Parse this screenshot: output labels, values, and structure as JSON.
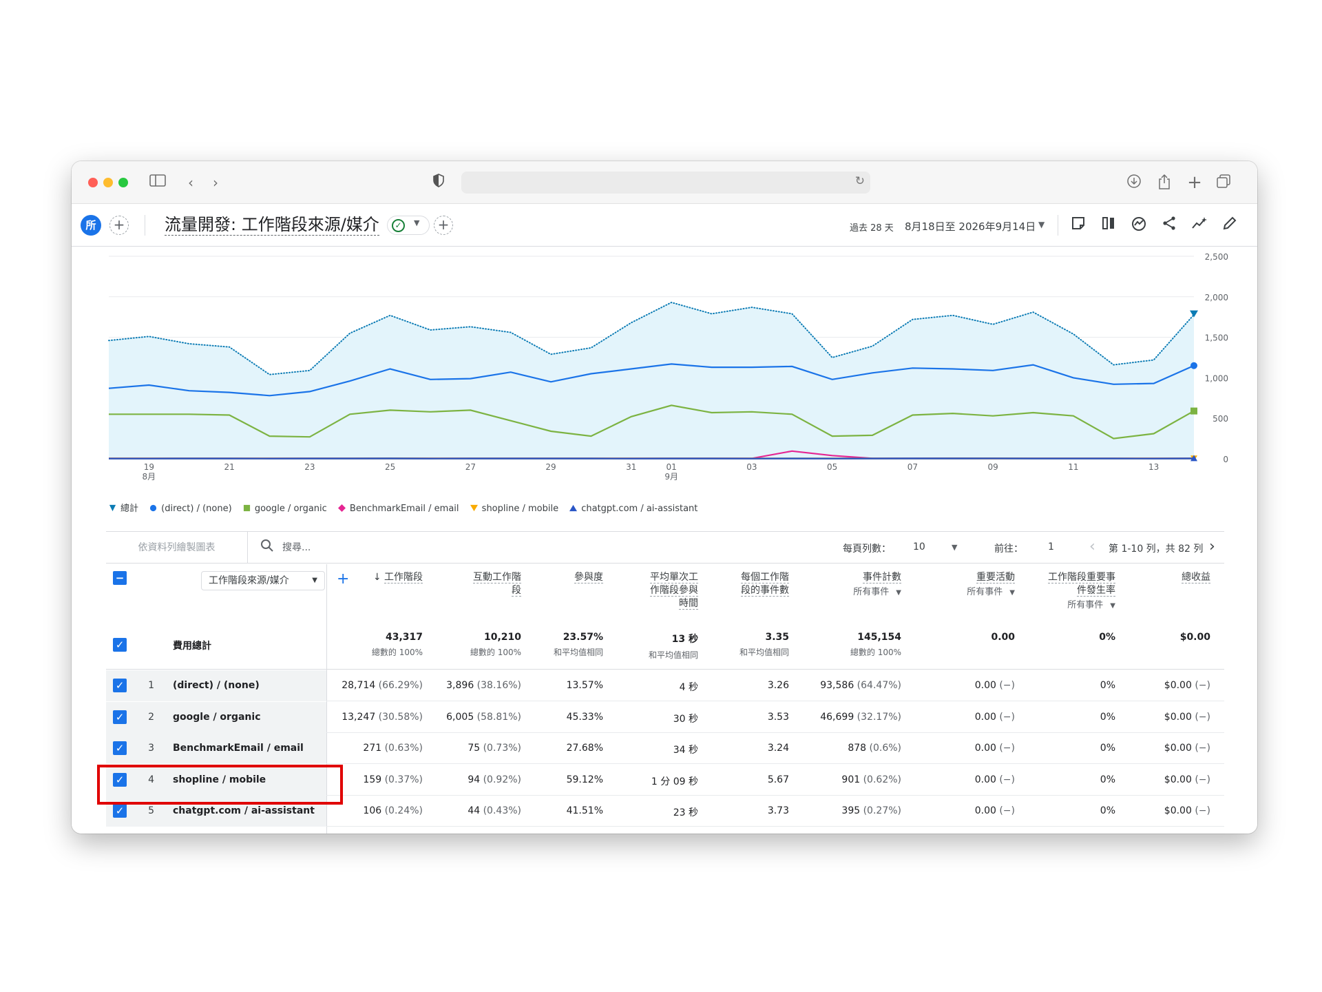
{
  "app": {
    "avatar": "所",
    "report_title": "流量開發: 工作階段來源/媒介",
    "date_label": "過去 28 天",
    "date_range": "8月18日至 2026年9月14日"
  },
  "chart_data": {
    "type": "line",
    "ylim": [
      0,
      2500
    ],
    "yticks": [
      "2,500",
      "2,000",
      "1,500",
      "1,000",
      "500",
      "0"
    ],
    "ytick_values": [
      2500,
      2000,
      1500,
      1000,
      500,
      0
    ],
    "xtick_labels": [
      {
        "i": 2,
        "day": "19",
        "month": "8月"
      },
      {
        "i": 4,
        "day": "21",
        "month": ""
      },
      {
        "i": 6,
        "day": "23",
        "month": ""
      },
      {
        "i": 8,
        "day": "25",
        "month": ""
      },
      {
        "i": 10,
        "day": "27",
        "month": ""
      },
      {
        "i": 12,
        "day": "29",
        "month": ""
      },
      {
        "i": 14,
        "day": "31",
        "month": ""
      },
      {
        "i": 15,
        "day": "01",
        "month": "9月"
      },
      {
        "i": 17,
        "day": "03",
        "month": ""
      },
      {
        "i": 19,
        "day": "05",
        "month": ""
      },
      {
        "i": 21,
        "day": "07",
        "month": ""
      },
      {
        "i": 23,
        "day": "09",
        "month": ""
      },
      {
        "i": 25,
        "day": "11",
        "month": ""
      },
      {
        "i": 27,
        "day": "13",
        "month": ""
      }
    ],
    "x": [
      "08-17",
      "08-18",
      "08-19",
      "08-20",
      "08-21",
      "08-22",
      "08-23",
      "08-24",
      "08-25",
      "08-26",
      "08-27",
      "08-28",
      "08-29",
      "08-30",
      "08-31",
      "09-01",
      "09-02",
      "09-03",
      "09-04",
      "09-05",
      "09-06",
      "09-07",
      "09-08",
      "09-09",
      "09-10",
      "09-11",
      "09-12",
      "09-13",
      "09-14"
    ],
    "series": [
      {
        "name": "總計",
        "color": "#0b7bb4",
        "style": "dotted-area",
        "values": [
          1460,
          1510,
          1420,
          1380,
          1040,
          1090,
          1550,
          1770,
          1590,
          1630,
          1560,
          1290,
          1370,
          1680,
          1930,
          1790,
          1870,
          1790,
          1250,
          1390,
          1720,
          1770,
          1660,
          1810,
          1540,
          1160,
          1220,
          1780
        ]
      },
      {
        "name": "(direct) / (none)",
        "color": "#1a73e8",
        "style": "line",
        "values": [
          870,
          910,
          840,
          820,
          780,
          830,
          960,
          1110,
          980,
          990,
          1070,
          950,
          1050,
          1110,
          1170,
          1130,
          1130,
          1140,
          980,
          1060,
          1120,
          1110,
          1090,
          1160,
          1000,
          920,
          930,
          1150
        ]
      },
      {
        "name": "google / organic",
        "color": "#7cb342",
        "style": "line",
        "values": [
          550,
          550,
          550,
          540,
          280,
          270,
          550,
          600,
          580,
          600,
          470,
          340,
          280,
          520,
          660,
          570,
          580,
          550,
          280,
          290,
          540,
          560,
          530,
          570,
          530,
          250,
          310,
          590
        ]
      },
      {
        "name": "BenchmarkEmail / email",
        "color": "#e52592",
        "style": "line",
        "values": [
          5,
          5,
          5,
          5,
          5,
          5,
          5,
          5,
          5,
          5,
          5,
          5,
          5,
          5,
          5,
          5,
          5,
          95,
          40,
          5,
          5,
          8,
          6,
          5,
          5,
          5,
          5,
          5
        ]
      },
      {
        "name": "shopline / mobile",
        "color": "#f9ab00",
        "style": "line",
        "values": [
          5,
          5,
          6,
          5,
          5,
          6,
          6,
          7,
          5,
          6,
          5,
          5,
          6,
          5,
          6,
          6,
          5,
          5,
          5,
          6,
          6,
          7,
          7,
          6,
          5,
          5,
          6,
          6
        ]
      },
      {
        "name": "chatgpt.com / ai-assistant",
        "color": "#2a56c6",
        "style": "line",
        "values": [
          3,
          3,
          4,
          4,
          3,
          4,
          4,
          5,
          3,
          4,
          4,
          4,
          4,
          3,
          4,
          4,
          3,
          4,
          3,
          4,
          5,
          5,
          6,
          4,
          4,
          4,
          3,
          5
        ]
      }
    ]
  },
  "legend_icons": [
    "pin-icon",
    "circle-icon",
    "square-icon",
    "diamond-icon",
    "triangle-down-icon",
    "triangle-up-icon"
  ],
  "toolbar": {
    "plot_rows_label": "依資料列繪製圖表",
    "search_placeholder": "搜尋...",
    "rows_per_page_label": "每頁列數：",
    "rows_per_page_value": "10",
    "goto_label": "前往：",
    "goto_value": "1",
    "pagination_text": "第 1-10 列，共 82 列"
  },
  "table": {
    "dimension_label": "工作階段來源/媒介",
    "columns": [
      {
        "title": "工作階段",
        "sorted": true,
        "sub": ""
      },
      {
        "title": "互動工作階段",
        "sub": ""
      },
      {
        "title": "參與度",
        "sub": ""
      },
      {
        "title": "平均單次工作階段參與時間",
        "sub": ""
      },
      {
        "title": "每個工作階段的事件數",
        "sub": ""
      },
      {
        "title": "事件計數",
        "sub": "所有事件"
      },
      {
        "title": "重要活動",
        "sub": "所有事件"
      },
      {
        "title": "工作階段重要事件發生率",
        "sub": "所有事件"
      },
      {
        "title": "總收益",
        "sub": ""
      }
    ],
    "col_title_lines": [
      [
        "工作階段"
      ],
      [
        "互動工作階",
        "段"
      ],
      [
        "參與度"
      ],
      [
        "平均單次工",
        "作階段參與",
        "時間"
      ],
      [
        "每個工作階",
        "段的事件數"
      ],
      [
        "事件計數"
      ],
      [
        "重要活動"
      ],
      [
        "工作階段重要事",
        "件發生率"
      ],
      [
        "總收益"
      ]
    ],
    "totals_label": "費用總計",
    "totals": [
      {
        "v": "43,317",
        "p": "總數的 100%"
      },
      {
        "v": "10,210",
        "p": "總數的 100%"
      },
      {
        "v": "23.57%",
        "p": "和平均值相同"
      },
      {
        "v": "13 秒",
        "p": "和平均值相同"
      },
      {
        "v": "3.35",
        "p": "和平均值相同"
      },
      {
        "v": "145,154",
        "p": "總數的 100%"
      },
      {
        "v": "0.00",
        "p": ""
      },
      {
        "v": "0%",
        "p": ""
      },
      {
        "v": "$0.00",
        "p": ""
      }
    ],
    "rows": [
      {
        "idx": "1",
        "dim": "(direct) / (none)",
        "cells": [
          [
            "28,714",
            "(66.29%)"
          ],
          [
            "3,896",
            "(38.16%)"
          ],
          [
            "13.57%",
            ""
          ],
          [
            "4 秒",
            ""
          ],
          [
            "3.26",
            ""
          ],
          [
            "93,586",
            "(64.47%)"
          ],
          [
            "0.00",
            "(−)"
          ],
          [
            "0%",
            ""
          ],
          [
            "$0.00",
            "(−)"
          ]
        ]
      },
      {
        "idx": "2",
        "dim": "google / organic",
        "cells": [
          [
            "13,247",
            "(30.58%)"
          ],
          [
            "6,005",
            "(58.81%)"
          ],
          [
            "45.33%",
            ""
          ],
          [
            "30 秒",
            ""
          ],
          [
            "3.53",
            ""
          ],
          [
            "46,699",
            "(32.17%)"
          ],
          [
            "0.00",
            "(−)"
          ],
          [
            "0%",
            ""
          ],
          [
            "$0.00",
            "(−)"
          ]
        ]
      },
      {
        "idx": "3",
        "dim": "BenchmarkEmail / email",
        "cells": [
          [
            "271",
            "(0.63%)"
          ],
          [
            "75",
            "(0.73%)"
          ],
          [
            "27.68%",
            ""
          ],
          [
            "34 秒",
            ""
          ],
          [
            "3.24",
            ""
          ],
          [
            "878",
            "(0.6%)"
          ],
          [
            "0.00",
            "(−)"
          ],
          [
            "0%",
            ""
          ],
          [
            "$0.00",
            "(−)"
          ]
        ]
      },
      {
        "idx": "4",
        "dim": "shopline / mobile",
        "cells": [
          [
            "159",
            "(0.37%)"
          ],
          [
            "94",
            "(0.92%)"
          ],
          [
            "59.12%",
            ""
          ],
          [
            "1 分 09 秒",
            ""
          ],
          [
            "5.67",
            ""
          ],
          [
            "901",
            "(0.62%)"
          ],
          [
            "0.00",
            "(−)"
          ],
          [
            "0%",
            ""
          ],
          [
            "$0.00",
            "(−)"
          ]
        ]
      },
      {
        "idx": "5",
        "dim": "chatgpt.com / ai-assistant",
        "cells": [
          [
            "106",
            "(0.24%)"
          ],
          [
            "44",
            "(0.43%)"
          ],
          [
            "41.51%",
            ""
          ],
          [
            "23 秒",
            ""
          ],
          [
            "3.73",
            ""
          ],
          [
            "395",
            "(0.27%)"
          ],
          [
            "0.00",
            "(−)"
          ],
          [
            "0%",
            ""
          ],
          [
            "$0.00",
            "(−)"
          ]
        ]
      }
    ]
  }
}
